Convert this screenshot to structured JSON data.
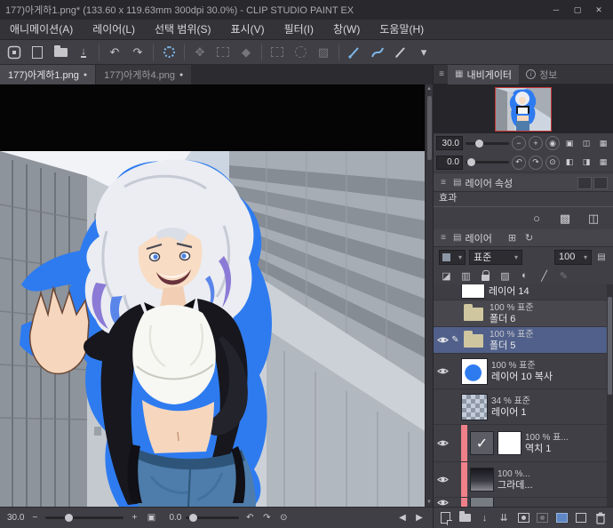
{
  "window": {
    "title": "177)아게하1.png* (133.60 x 119.63mm 300dpi 30.0%) - CLIP STUDIO PAINT EX"
  },
  "menu": {
    "items": [
      "애니메이션(A)",
      "레이어(L)",
      "선택 범위(S)",
      "표시(V)",
      "필터(I)",
      "창(W)",
      "도움말(H)"
    ]
  },
  "doc_tabs": [
    {
      "label": "177)아게하1.png"
    },
    {
      "label": "177)아게하4.png"
    }
  ],
  "navigator": {
    "tab": "내비게이터",
    "info_tab": "정보",
    "zoom_value": "30.0",
    "rotation_value": "0.0"
  },
  "layer_property": {
    "title": "레이어 속성",
    "effect_label": "효과"
  },
  "layer_panel": {
    "title": "레이어",
    "blend_mode": "표준",
    "opacity": "100",
    "rows": [
      {
        "info": "",
        "name": "레이어 14"
      },
      {
        "info": "100 % 표준",
        "name": "폴더 6"
      },
      {
        "info": "100 % 표준",
        "name": "폴더 5"
      },
      {
        "info": "100 % 표준",
        "name": "레이어 10 복사"
      },
      {
        "info": "34 % 표준",
        "name": "레이어 1"
      },
      {
        "info": "100 % 표...",
        "name": "역치 1"
      },
      {
        "info": "100 %...",
        "name": "그라데..."
      }
    ]
  },
  "status_bar": {
    "zoom": "30.0",
    "rotation": "0.0"
  },
  "colors": {
    "accent_blue": "#2e7bf0",
    "selected_row": "#50608a",
    "layer_label_pink": "#ef8089",
    "navigator_view_border": "#c23434"
  },
  "icons": {
    "minimize": "─",
    "maximize": "▢",
    "close": "✕",
    "dirty_dot": "●",
    "panel_menu": "≡",
    "navigator_glyph": "▦",
    "info_glyph": "i",
    "zoom_out": "−",
    "zoom_in": "+",
    "zoom_100": "◉",
    "fit_screen": "▣",
    "fit_window": "◫",
    "nav_grid": "▦",
    "undo": "↶",
    "redo": "↷",
    "reset_rotation": "⊙",
    "flip_horizontal": "◧",
    "flip_vertical": "◨",
    "dropdown": "▾",
    "border_effect": "○",
    "tone_effect": "▩",
    "layer_color_effect": "◫",
    "layer_panel_glyph": "▤",
    "header_icon_1": "⊞",
    "header_icon_2": "↻",
    "pencil": "✎",
    "check": "✓",
    "arrow_left": "◀",
    "arrow_right": "▶",
    "arrow_up": "▲",
    "arrow_down": "▼",
    "transfer_down": "↓",
    "merge_down": "⇊",
    "opacity_slider": "▤",
    "lock_glyphs": [
      "◪",
      "▥",
      "▨",
      "◐",
      "╱"
    ]
  }
}
